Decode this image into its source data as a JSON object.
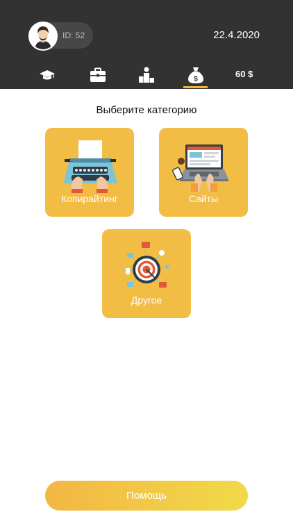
{
  "header": {
    "user_id": "ID: 52",
    "date": "22.4.2020",
    "tabs": [
      {
        "icon": "graduation-cap-icon"
      },
      {
        "icon": "briefcase-icon"
      },
      {
        "icon": "podium-icon"
      },
      {
        "icon": "money-bag-icon",
        "active": true
      }
    ],
    "balance": "60 $"
  },
  "main": {
    "prompt": "Выберите категорию",
    "categories": [
      {
        "label": "Копирайтинг",
        "icon": "typewriter-icon"
      },
      {
        "label": "Сайты",
        "icon": "laptop-icon"
      },
      {
        "label": "Другое",
        "icon": "target-icon"
      }
    ]
  },
  "footer": {
    "help_label": "Помощь"
  },
  "colors": {
    "header_bg": "#323232",
    "accent": "#f2b33d",
    "card_bg": "#f2bd45"
  }
}
